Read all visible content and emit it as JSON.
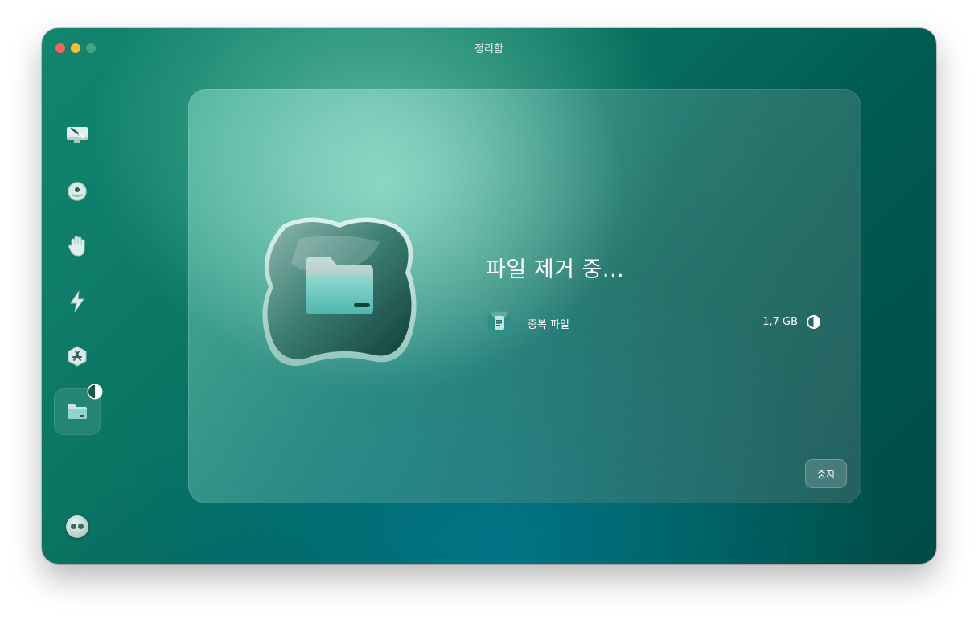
{
  "window": {
    "title": "정리함"
  },
  "sidebar": {
    "items": [
      {
        "name": "smart-scan",
        "icon": "monitor-brush-icon"
      },
      {
        "name": "cleanup",
        "icon": "bubble-icon"
      },
      {
        "name": "protection",
        "icon": "hand-icon"
      },
      {
        "name": "performance",
        "icon": "lightning-icon"
      },
      {
        "name": "applications",
        "icon": "app-store-icon"
      },
      {
        "name": "my-clutter",
        "icon": "folder-icon",
        "active": true
      }
    ],
    "assistant_icon": "assistant-icon"
  },
  "main": {
    "status_title": "파일 제거 중...",
    "task": {
      "label": "중복 파일",
      "size": "1,7 GB",
      "progress": 0.5,
      "icon": "duplicate-file-icon"
    },
    "stop_label": "중지"
  },
  "colors": {
    "accent": "#12866f",
    "window_dark": "#004c47",
    "traffic_red": "#ff5f57",
    "traffic_yellow": "#febc2e",
    "traffic_green": "#4fa884"
  }
}
